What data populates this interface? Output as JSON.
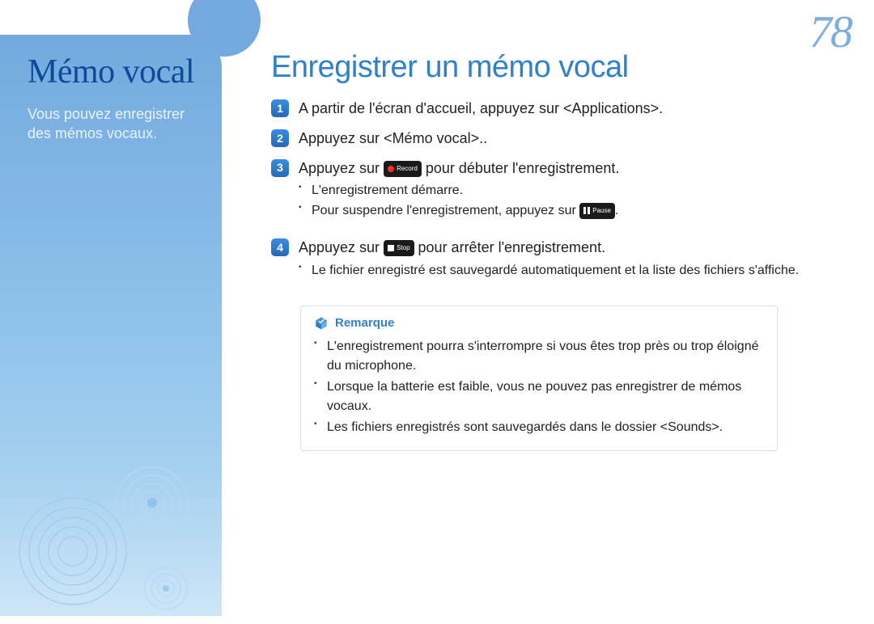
{
  "page_number": "78",
  "sidebar": {
    "title": "Mémo vocal",
    "subtitle": "Vous pouvez enregistrer des mémos vocaux."
  },
  "main": {
    "title": "Enregistrer un mémo vocal",
    "steps": [
      {
        "num": "1",
        "text_before": "A partir de l'écran d'accueil, appuyez sur <Applications>.",
        "button": null,
        "text_after": "",
        "bullets": []
      },
      {
        "num": "2",
        "text_before": "Appuyez sur <Mémo vocal>..",
        "button": null,
        "text_after": "",
        "bullets": []
      },
      {
        "num": "3",
        "text_before": "Appuyez sur ",
        "button": {
          "kind": "record",
          "label": "Record"
        },
        "text_after": " pour débuter l'enregistrement.",
        "bullets": [
          {
            "before": "L'enregistrement démarre.",
            "button": null,
            "after": ""
          },
          {
            "before": "Pour suspendre l'enregistrement, appuyez sur ",
            "button": {
              "kind": "pause",
              "label": "Pause"
            },
            "after": "."
          }
        ]
      },
      {
        "num": "4",
        "text_before": "Appuyez sur ",
        "button": {
          "kind": "stop",
          "label": "Stop"
        },
        "text_after": " pour arrêter l'enregistrement.",
        "bullets": [
          {
            "before": "Le fichier enregistré est sauvegardé automatiquement et la liste des fichiers s'affiche.",
            "button": null,
            "after": ""
          }
        ]
      }
    ],
    "remark": {
      "label": "Remarque",
      "items": [
        "L'enregistrement pourra s'interrompre si vous êtes trop près ou trop éloigné du microphone.",
        "Lorsque la batterie est faible, vous ne pouvez pas enregistrer de mémos vocaux.",
        "Les fichiers enregistrés sont sauvegardés dans le dossier <Sounds>."
      ]
    }
  }
}
